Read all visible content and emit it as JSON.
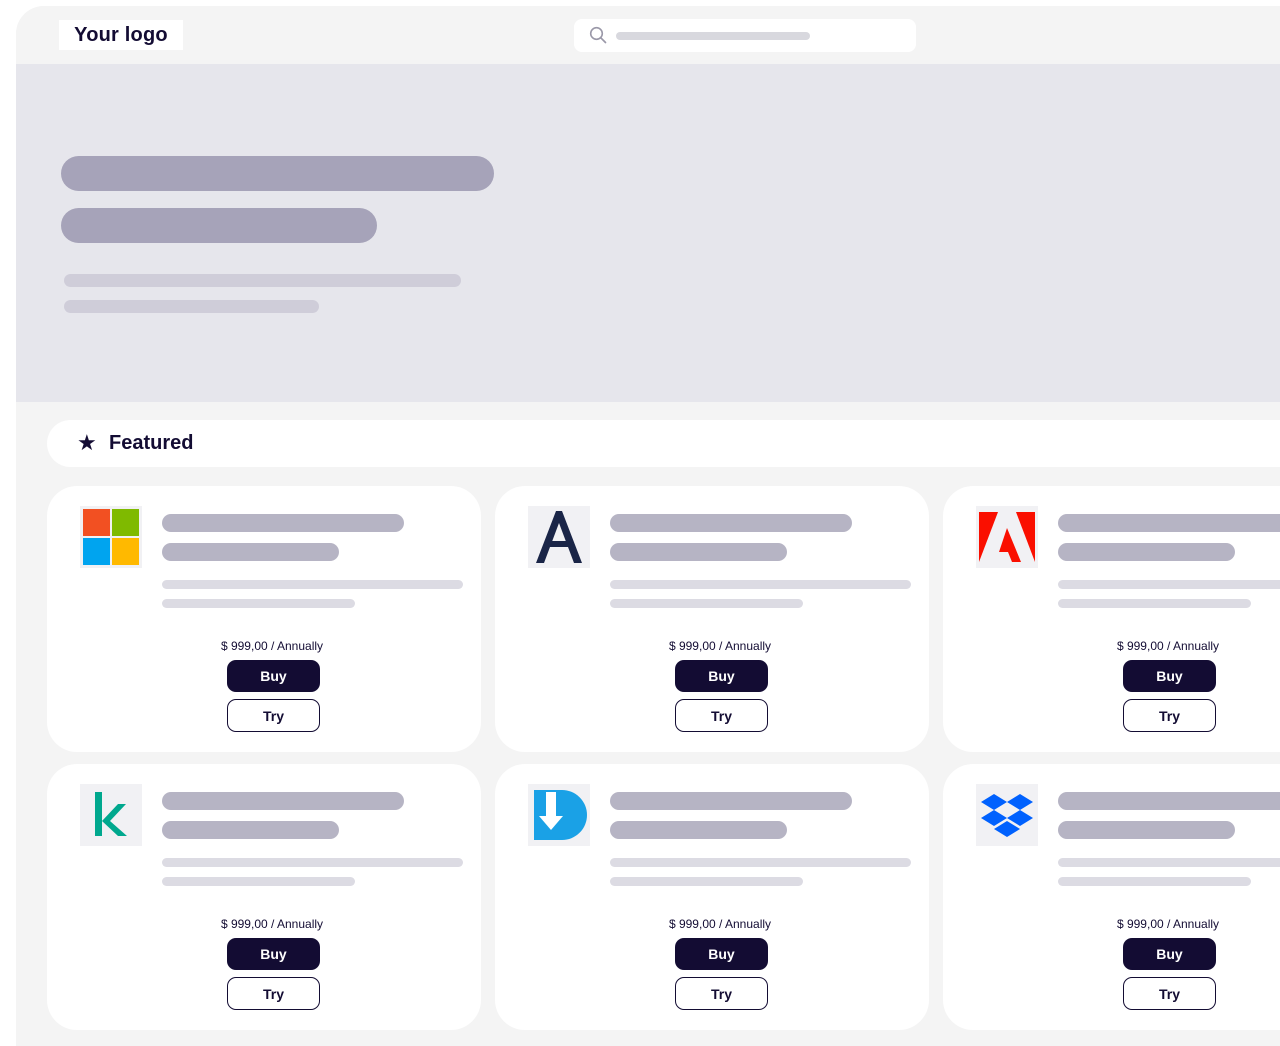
{
  "header": {
    "logo_text": "Your logo",
    "search_icon": "search-icon"
  },
  "featured": {
    "star_icon": "star-icon",
    "label": "Featured"
  },
  "products": [
    {
      "logo": "microsoft-logo-icon",
      "price": "$ 999,00 / Annually",
      "buy_label": "Buy",
      "try_label": "Try"
    },
    {
      "logo": "acronis-logo-icon",
      "price": "$ 999,00 / Annually",
      "buy_label": "Buy",
      "try_label": "Try"
    },
    {
      "logo": "adobe-logo-icon",
      "price": "$ 999,00 / Annually",
      "buy_label": "Buy",
      "try_label": "Try"
    },
    {
      "logo": "kaspersky-logo-icon",
      "price": "$ 999,00 / Annually",
      "buy_label": "Buy",
      "try_label": "Try"
    },
    {
      "logo": "download-arrow-logo-icon",
      "price": "$ 999,00 / Annually",
      "buy_label": "Buy",
      "try_label": "Try"
    },
    {
      "logo": "dropbox-logo-icon",
      "price": "$ 999,00 / Annually",
      "buy_label": "Buy",
      "try_label": "Try"
    }
  ],
  "colors": {
    "brand_dark": "#130c33",
    "page_bg": "#f4f4f4",
    "hero_bg": "#e6e6ec",
    "placeholder_dark": "#a6a3b9",
    "placeholder_mid": "#b6b4c4",
    "placeholder_light": "#dcdbe3"
  }
}
